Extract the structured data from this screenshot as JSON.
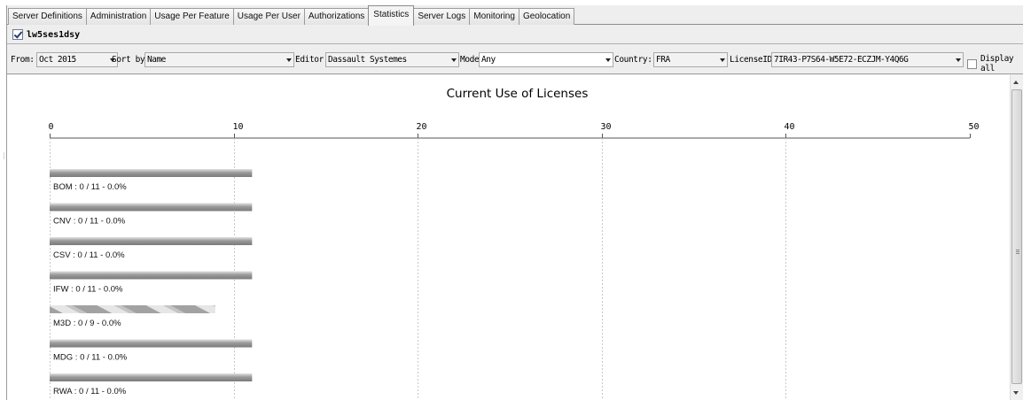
{
  "tabs": [
    {
      "label": "Server Definitions",
      "active": false
    },
    {
      "label": "Administration",
      "active": false
    },
    {
      "label": "Usage Per Feature",
      "active": false
    },
    {
      "label": "Usage Per User",
      "active": false
    },
    {
      "label": "Authorizations",
      "active": false
    },
    {
      "label": "Statistics",
      "active": true
    },
    {
      "label": "Server Logs",
      "active": false
    },
    {
      "label": "Monitoring",
      "active": false
    },
    {
      "label": "Geolocation",
      "active": false
    }
  ],
  "server": {
    "name": "lw5ses1dsy",
    "checked": true
  },
  "filters": {
    "from_label": "From:",
    "from_value": "Oct 2015",
    "sortby_label": "Sort by:",
    "sortby_value": "Name",
    "editor_label": "Editor:",
    "editor_value": "Dassault Systemes",
    "model_label": "Model:",
    "model_value": "Any",
    "country_label": "Country:",
    "country_value": "FRA",
    "licenseid_label": "LicenseID:",
    "licenseid_value": "7IR43-P7S64-W5E72-ECZJM-Y4Q6G",
    "display_all_label": "Display all",
    "display_all_checked": false
  },
  "chart_data": {
    "type": "bar",
    "orientation": "horizontal",
    "title": "Current Use of Licenses",
    "xlim": [
      0,
      50
    ],
    "ticks": [
      0,
      10,
      20,
      30,
      40,
      50
    ],
    "grid": true,
    "series": [
      {
        "name": "BOM",
        "in_use": 0,
        "total": 11,
        "label": "BOM : 0 / 11 - 0.0%",
        "pattern": "solid"
      },
      {
        "name": "CNV",
        "in_use": 0,
        "total": 11,
        "label": "CNV : 0 / 11 - 0.0%",
        "pattern": "solid"
      },
      {
        "name": "CSV",
        "in_use": 0,
        "total": 11,
        "label": "CSV : 0 / 11 - 0.0%",
        "pattern": "solid"
      },
      {
        "name": "IFW",
        "in_use": 0,
        "total": 11,
        "label": "IFW : 0 / 11 - 0.0%",
        "pattern": "solid"
      },
      {
        "name": "M3D",
        "in_use": 0,
        "total": 9,
        "label": "M3D : 0 / 9 - 0.0%",
        "pattern": "striped"
      },
      {
        "name": "MDG",
        "in_use": 0,
        "total": 11,
        "label": "MDG : 0 / 11 - 0.0%",
        "pattern": "solid"
      },
      {
        "name": "RWA",
        "in_use": 0,
        "total": 11,
        "label": "RWA : 0 / 11 - 0.0%",
        "pattern": "solid"
      }
    ]
  }
}
